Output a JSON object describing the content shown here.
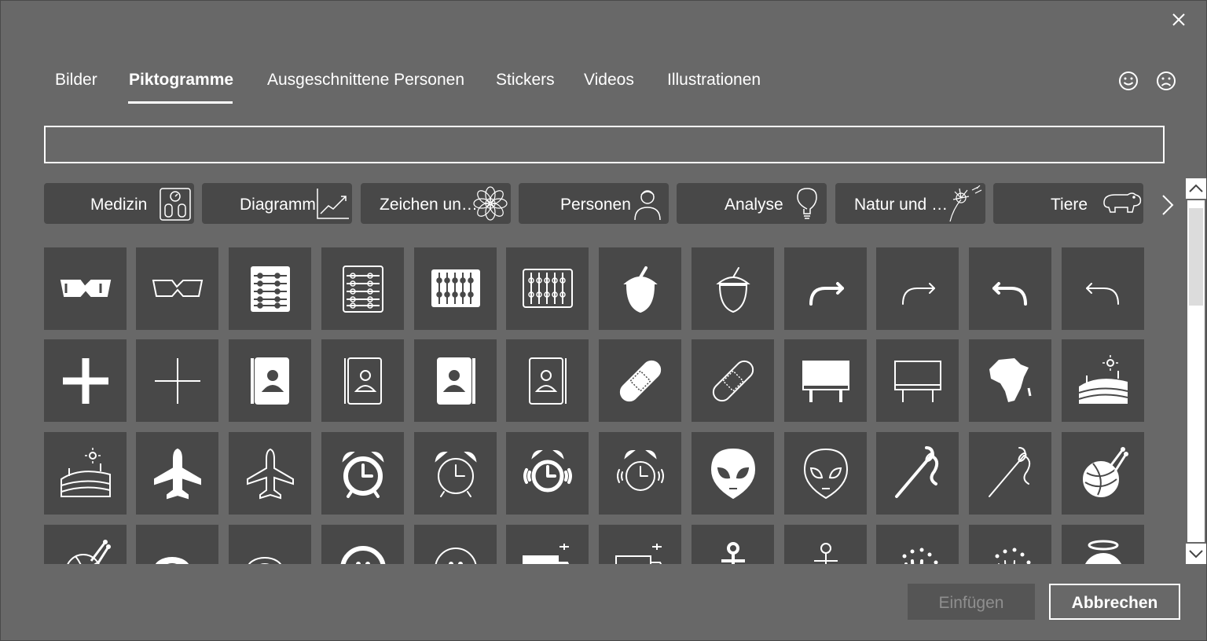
{
  "tabs": [
    {
      "label": "Bilder"
    },
    {
      "label": "Piktogramme"
    },
    {
      "label": "Ausgeschnittene Personen"
    },
    {
      "label": "Stickers"
    },
    {
      "label": "Videos"
    },
    {
      "label": "Illustrationen"
    }
  ],
  "active_tab": "Piktogramme",
  "search": {
    "value": "",
    "placeholder": ""
  },
  "categories": [
    {
      "label": "Medizin",
      "icon": "scale-icon"
    },
    {
      "label": "Diagramm",
      "icon": "line-chart-icon"
    },
    {
      "label": "Zeichen und...",
      "icon": "mandala-icon"
    },
    {
      "label": "Personen",
      "icon": "person-icon"
    },
    {
      "label": "Analyse",
      "icon": "lightbulb-icon"
    },
    {
      "label": "Natur und Dr...",
      "icon": "dandelion-icon"
    },
    {
      "label": "Tiere",
      "icon": "hippo-icon"
    }
  ],
  "icons": [
    "3d-glasses-filled",
    "3d-glasses-outline",
    "abacus-filled",
    "abacus-outline",
    "abacus-wide-filled",
    "abacus-wide-outline",
    "acorn-filled",
    "acorn-outline",
    "arrow-turn-right-filled",
    "arrow-turn-right-outline",
    "arrow-turn-left-filled",
    "arrow-turn-left-outline",
    "add-filled",
    "add-outline",
    "address-book-filled",
    "address-book-outline",
    "address-book-alt-filled",
    "address-book-alt-outline",
    "bandage-filled",
    "bandage-outline",
    "billboard-filled",
    "billboard-outline",
    "africa-filled",
    "farm-filled",
    "farm-outline",
    "airplane-filled",
    "airplane-outline",
    "alarm-clock-filled",
    "alarm-clock-outline",
    "alarm-ringing-filled",
    "alarm-ringing-outline",
    "alien-face-filled",
    "alien-face-outline",
    "needle-thread-filled",
    "needle-thread-outline",
    "yarn-filled",
    "yarn-outline",
    "tape-measure-filled",
    "tape-measure-outline",
    "button-filled",
    "button-outline",
    "ambulance-filled",
    "ambulance-outline",
    "anchor-filled",
    "anchor-outline",
    "sea-anemone-filled",
    "sea-anemone-outline",
    "angel-face-filled"
  ],
  "buttons": {
    "insert": "Einfügen",
    "cancel": "Abbrechen"
  },
  "colors": {
    "background": "#686868",
    "tile": "#484848",
    "text": "#ffffff",
    "disabled_text": "#8f8f8f"
  }
}
